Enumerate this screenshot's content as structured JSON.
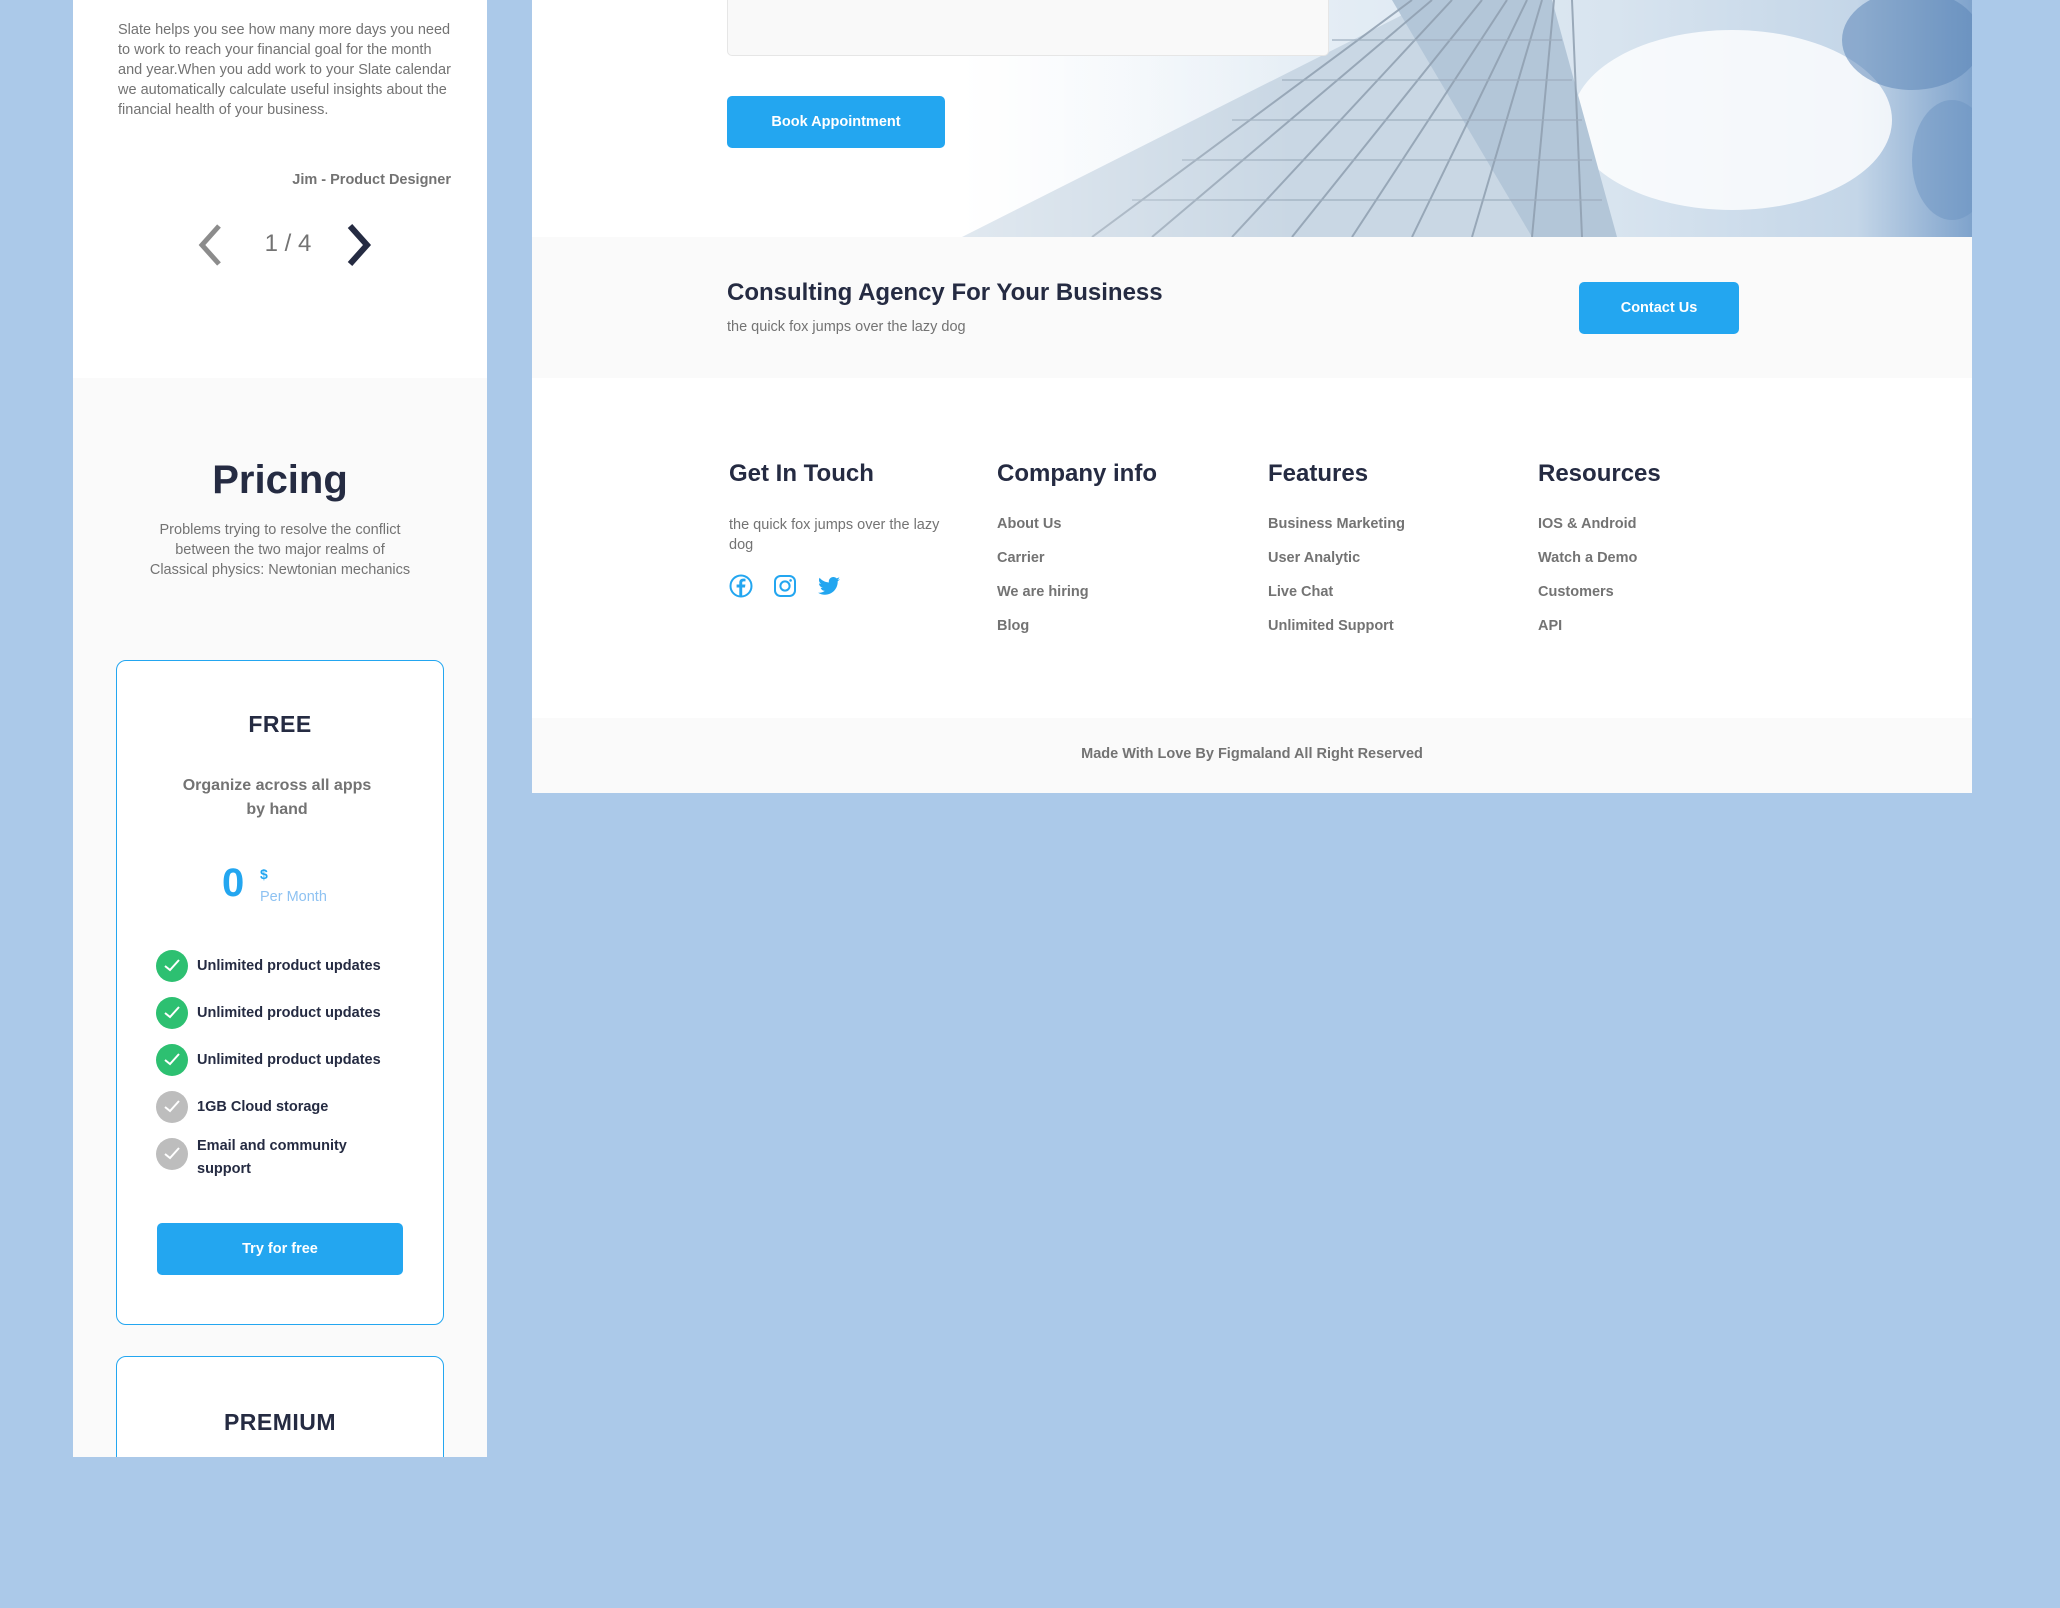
{
  "colors": {
    "page_background": "#abc9e9",
    "primary": "#23a6f0",
    "heading": "#252b42",
    "muted_text": "#737373",
    "check_active": "#2dc071",
    "check_inactive": "#bdbdbd"
  },
  "mobile": {
    "testimonial": {
      "text": "Slate helps you see how many more days you need to work to reach your financial goal for the month and year.When you add work to your Slate calendar we automatically calculate useful insights about the financial health of your business.",
      "author": "Jim - Product Designer",
      "counter": "1 / 4",
      "prev_icon": "chevron-left-icon",
      "next_icon": "chevron-right-icon"
    },
    "pricing": {
      "title": "Pricing",
      "subtitle": "Problems trying to resolve the conflict between the two major realms of Classical physics: Newtonian mechanics",
      "plans": [
        {
          "name": "FREE",
          "description": "Organize across all apps by hand",
          "price": "0",
          "currency": "$",
          "period": "Per Month",
          "features": [
            {
              "text": "Unlimited product updates",
              "included": true
            },
            {
              "text": "Unlimited product updates",
              "included": true
            },
            {
              "text": "Unlimited product updates",
              "included": true
            },
            {
              "text": "1GB  Cloud storage",
              "included": false
            },
            {
              "text": "Email and community support",
              "included": false
            }
          ],
          "cta": "Try for free"
        },
        {
          "name": "PREMIUM"
        }
      ]
    }
  },
  "desktop": {
    "appointment": {
      "book_button": "Book Appointment"
    },
    "cta": {
      "title": "Consulting Agency For Your Business",
      "subtitle": "the quick fox jumps over the lazy dog",
      "button": "Contact Us"
    },
    "footer": {
      "get_in_touch": {
        "heading": "Get In Touch",
        "text": "the quick fox jumps over the lazy dog",
        "socials": [
          "facebook-icon",
          "instagram-icon",
          "twitter-icon"
        ]
      },
      "company_info": {
        "heading": "Company info",
        "links": [
          "About Us",
          "Carrier",
          "We are hiring",
          "Blog"
        ]
      },
      "features": {
        "heading": "Features",
        "links": [
          "Business Marketing",
          "User Analytic",
          "Live Chat",
          "Unlimited Support"
        ]
      },
      "resources": {
        "heading": "Resources",
        "links": [
          "IOS & Android",
          "Watch a Demo",
          "Customers",
          "API"
        ]
      },
      "copyright": "Made With Love By Figmaland All Right Reserved"
    }
  }
}
